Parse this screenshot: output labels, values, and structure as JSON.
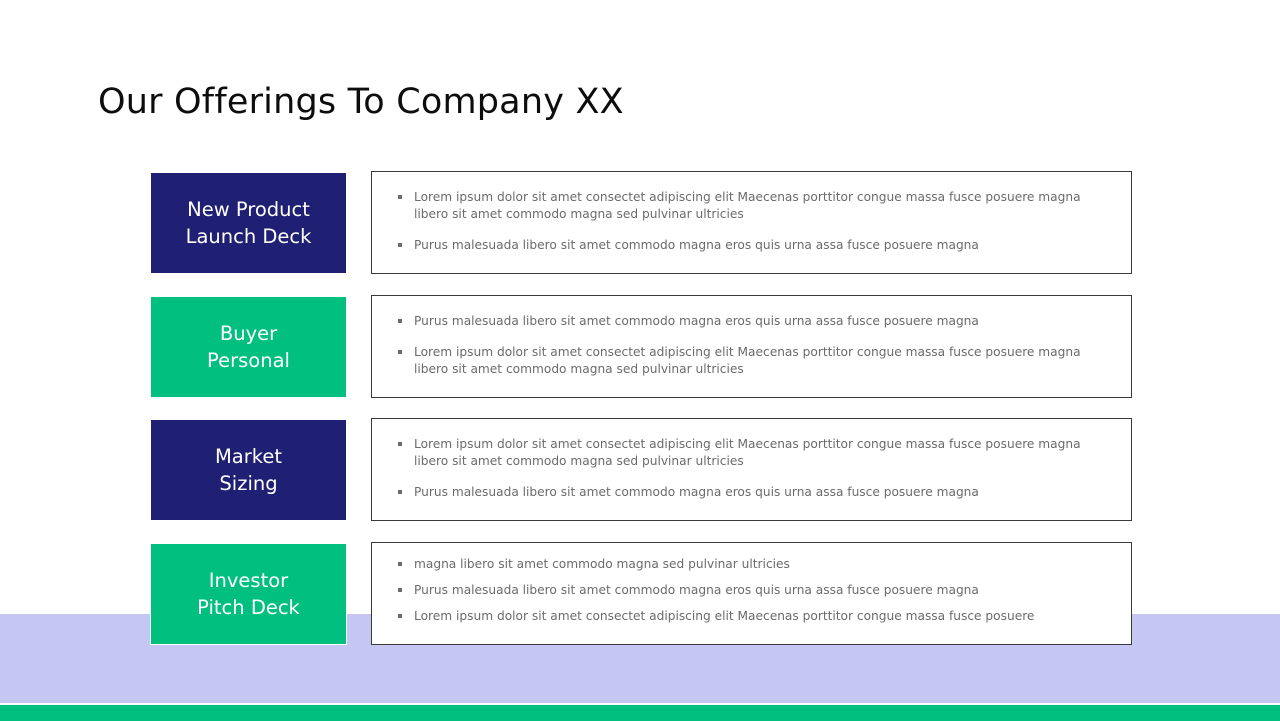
{
  "title": "Our Offerings To Company XX",
  "colors": {
    "navy": "#1f1f73",
    "green": "#00bf7f",
    "lavender_band": "#c6c6f2",
    "bullet_text": "#6b6b6b"
  },
  "offerings": [
    {
      "label": "New Product\nLaunch Deck",
      "bullets": [
        "Lorem ipsum dolor sit amet consectet adipiscing elit Maecenas porttitor congue massa fusce posuere magna\nlibero sit amet commodo magna sed pulvinar ultricies",
        "Purus malesuada libero sit amet commodo magna eros quis urna assa fusce posuere magna"
      ]
    },
    {
      "label": "Buyer\nPersonal",
      "bullets": [
        "Purus malesuada libero sit amet commodo magna eros quis urna assa fusce posuere magna",
        "Lorem ipsum dolor sit amet consectet adipiscing elit Maecenas porttitor congue massa fusce posuere magna\nlibero sit amet commodo magna sed pulvinar ultricies"
      ]
    },
    {
      "label": "Market\nSizing",
      "bullets": [
        "Lorem ipsum dolor sit amet consectet adipiscing elit Maecenas porttitor congue massa fusce posuere magna\nlibero sit amet commodo magna sed pulvinar ultricies",
        "Purus malesuada libero sit amet commodo magna eros quis urna assa fusce posuere magna"
      ]
    },
    {
      "label": "Investor\nPitch Deck",
      "bullets": [
        "magna libero sit amet commodo magna sed pulvinar ultricies",
        "Purus malesuada libero sit amet commodo magna eros quis urna assa fusce posuere magna",
        "Lorem ipsum dolor sit amet consectet adipiscing elit Maecenas porttitor congue massa fusce posuere"
      ]
    }
  ]
}
